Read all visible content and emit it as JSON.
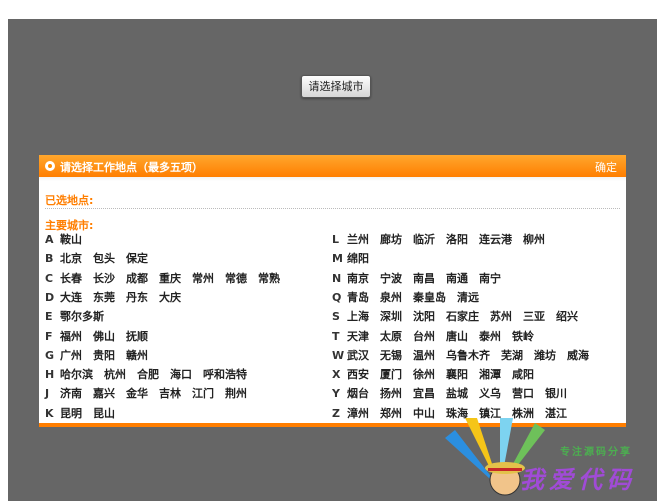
{
  "select_button": "请选择城市",
  "dialog": {
    "title": "请选择工作地点（最多五项）",
    "confirm": "确定",
    "selected_label": "已选地点:",
    "main_label": "主要城市:"
  },
  "left_groups": [
    {
      "letter": "A",
      "cities": [
        "鞍山"
      ]
    },
    {
      "letter": "B",
      "cities": [
        "北京",
        "包头",
        "保定"
      ]
    },
    {
      "letter": "C",
      "cities": [
        "长春",
        "长沙",
        "成都",
        "重庆",
        "常州",
        "常德",
        "常熟"
      ]
    },
    {
      "letter": "D",
      "cities": [
        "大连",
        "东莞",
        "丹东",
        "大庆"
      ]
    },
    {
      "letter": "E",
      "cities": [
        "鄂尔多斯"
      ]
    },
    {
      "letter": "F",
      "cities": [
        "福州",
        "佛山",
        "抚顺"
      ]
    },
    {
      "letter": "G",
      "cities": [
        "广州",
        "贵阳",
        "赣州"
      ]
    },
    {
      "letter": "H",
      "cities": [
        "哈尔滨",
        "杭州",
        "合肥",
        "海口",
        "呼和浩特"
      ]
    },
    {
      "letter": "J",
      "cities": [
        "济南",
        "嘉兴",
        "金华",
        "吉林",
        "江门",
        "荆州"
      ]
    },
    {
      "letter": "K",
      "cities": [
        "昆明",
        "昆山"
      ]
    }
  ],
  "right_groups": [
    {
      "letter": "L",
      "cities": [
        "兰州",
        "廊坊",
        "临沂",
        "洛阳",
        "连云港",
        "柳州"
      ]
    },
    {
      "letter": "M",
      "cities": [
        "绵阳"
      ]
    },
    {
      "letter": "N",
      "cities": [
        "南京",
        "宁波",
        "南昌",
        "南通",
        "南宁"
      ]
    },
    {
      "letter": "Q",
      "cities": [
        "青岛",
        "泉州",
        "秦皇岛",
        "清远"
      ]
    },
    {
      "letter": "S",
      "cities": [
        "上海",
        "深圳",
        "沈阳",
        "石家庄",
        "苏州",
        "三亚",
        "绍兴"
      ]
    },
    {
      "letter": "T",
      "cities": [
        "天津",
        "太原",
        "台州",
        "唐山",
        "泰州",
        "铁岭"
      ]
    },
    {
      "letter": "W",
      "cities": [
        "武汉",
        "无锡",
        "温州",
        "乌鲁木齐",
        "芜湖",
        "潍坊",
        "威海"
      ]
    },
    {
      "letter": "X",
      "cities": [
        "西安",
        "厦门",
        "徐州",
        "襄阳",
        "湘潭",
        "咸阳"
      ]
    },
    {
      "letter": "Y",
      "cities": [
        "烟台",
        "扬州",
        "宜昌",
        "盐城",
        "义乌",
        "营口",
        "银川"
      ]
    },
    {
      "letter": "Z",
      "cities": [
        "漳州",
        "郑州",
        "中山",
        "珠海",
        "镇江",
        "株洲",
        "湛江"
      ]
    }
  ],
  "watermark": {
    "slogan": "专注源码分享",
    "brand": "我爱代码"
  }
}
